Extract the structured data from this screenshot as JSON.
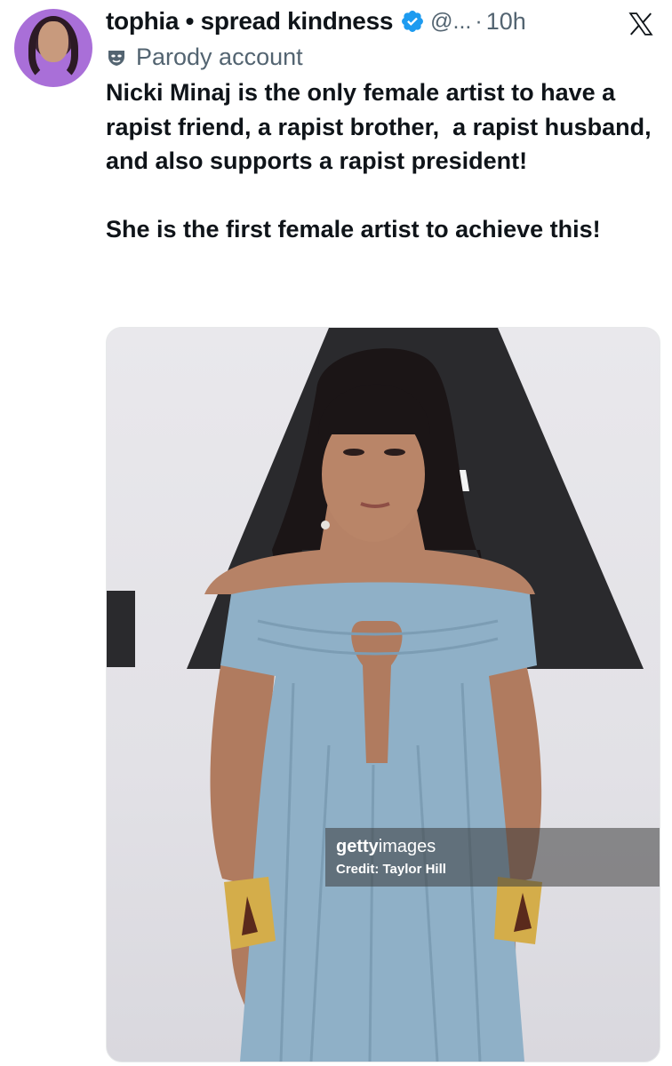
{
  "post": {
    "display_name": "tophia • spread kindness",
    "handle": "@...",
    "separator": "·",
    "time": "10h",
    "account_label": "Parody account",
    "text": "Nicki Minaj is the only female artist to have a rapist friend, a rapist brother,  a rapist husband, and also supports a rapist president!\n\nShe is the first female artist to achieve this!"
  },
  "media": {
    "watermark_brand_bold": "getty",
    "watermark_brand_light": "images",
    "watermark_credit": "Credit: Taylor Hill"
  },
  "icons": {
    "verified": "verified-badge-icon",
    "parody": "mask-icon",
    "platform": "x-logo-icon"
  },
  "colors": {
    "verified": "#1d9bf0",
    "secondary_text": "#536471",
    "dress": "#8fb0c7",
    "avatar_bg": "#a96fd8"
  }
}
